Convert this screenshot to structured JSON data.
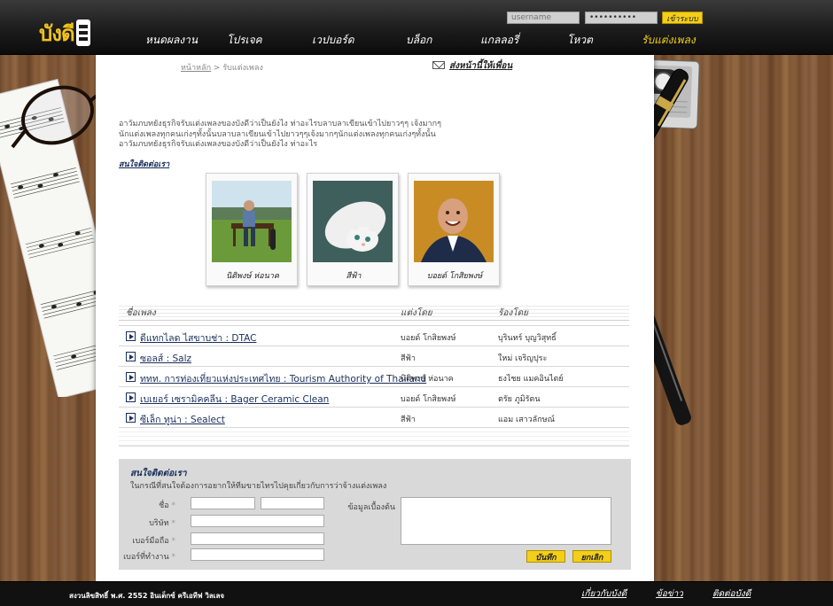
{
  "brand": {
    "logo_text": "บังดี"
  },
  "login": {
    "username_placeholder": "username",
    "password_value": "••••••••••",
    "button_label": "เข้าระบบ"
  },
  "nav": {
    "items": [
      "หนดผลงาน",
      "โปรเจค",
      "เวปบอร์ด",
      "บล็อก",
      "แกลลอรี่",
      "โหวต",
      "รับแต่งเพลง"
    ],
    "active_index": 6
  },
  "breadcrumb": {
    "home": "หน้าหลัก",
    "separator": ">",
    "current": "รับแต่งเพลง"
  },
  "mailer": {
    "label": "ส่งหน้านี้ให้เพื่อน"
  },
  "intro": {
    "lines": [
      "อาวัมภบทยังธุรกิจรับแต่งเพลงของบังดีว่าเป็นยังไง ท่าอะไรบลาบลาเขียนเข้าไปยาวๆๆ เจ้งมากๆ",
      "นักแต่งเพลงทุกคนเก่งๆทั้งนั้นบลาบลาเขียนเข้าไปยาวๆๆเจ้งมากๆนักแต่งเพลงทุกคนเก่งๆทั้งนั้น",
      "อาวัมภบทยังธุรกิจรับแต่งเพลงของบังดีว่าเป็นยังไง ท่าอะไร"
    ],
    "contact_link": "สนใจติดต่อเรา"
  },
  "team": [
    {
      "name": "นิติพงษ์ ห่อนาค",
      "photo": "man-on-bench-photo"
    },
    {
      "name": "สีฟ้า",
      "photo": "white-cat-photo"
    },
    {
      "name": "บอยด์ โกสิยพงษ์",
      "photo": "smiling-man-photo"
    }
  ],
  "songs": {
    "headers": {
      "title": "ชื่อเพลง",
      "composer": "แต่งโดย",
      "singer": "ร้องโดย"
    },
    "rows": [
      {
        "title": "ดีแทกไลด ไสขาบช่า : DTAC",
        "composer": "บอยด์ โกสิยพงษ์",
        "singer": "บุรินทร์ บุญวิสุทธิ์"
      },
      {
        "title": "ซอลส์ : Salz",
        "composer": "สีฟ้า",
        "singer": "ใหม่ เจริญปุระ"
      },
      {
        "title": "ททท. การท่องเที่ยวแห่งประเทศไทย : Tourism Authority of Thailand",
        "composer": "นิติพงษ์ ห่อนาค",
        "singer": "ธงไชย แมคอินไตย์"
      },
      {
        "title": "เบเยอร์ เซรามิคคลีน : Bager Ceramic Clean",
        "composer": "บอยด์ โกสิยพงษ์",
        "singer": "ตรัย ภูมิรัตน"
      },
      {
        "title": "ซีเล็ก ทูน่า : Sealect",
        "composer": "สีฟ้า",
        "singer": "แอม เสาวลักษณ์"
      }
    ]
  },
  "contact_form": {
    "title": "สนใจติดต่อเรา",
    "description": "ในกรณีที่สนใจต้องการอยากให้ทีมขายไทรไปคุยเกี่ยวกับการว่าจ้างแต่งเพลง",
    "fields": {
      "name": "ชื่อ",
      "company": "บริษัท",
      "mobile": "เบอร์มือถือ",
      "office_phone": "เบอร์ที่ทำงาน",
      "details": "ข้อมูลเบื้องต้น"
    },
    "required_mark": "*",
    "submit_label": "บันทึก",
    "cancel_label": "ยกเลิก"
  },
  "footer": {
    "copyright": "สงวนลิขสิทธิ์ พ.ศ. 2552 อินเด็กซ์ ครีเอทีฟ วิลเลจ",
    "links": [
      "เกี่ยวกับบังดี",
      "ข้อข่าว",
      "ติดต่อบังดี"
    ]
  },
  "colors": {
    "accent": "#f4cf19",
    "header_bg": "#1c1c1c",
    "link": "#1a2f5a",
    "form_bg": "#d9d9d9",
    "wood": "#7a5232"
  }
}
